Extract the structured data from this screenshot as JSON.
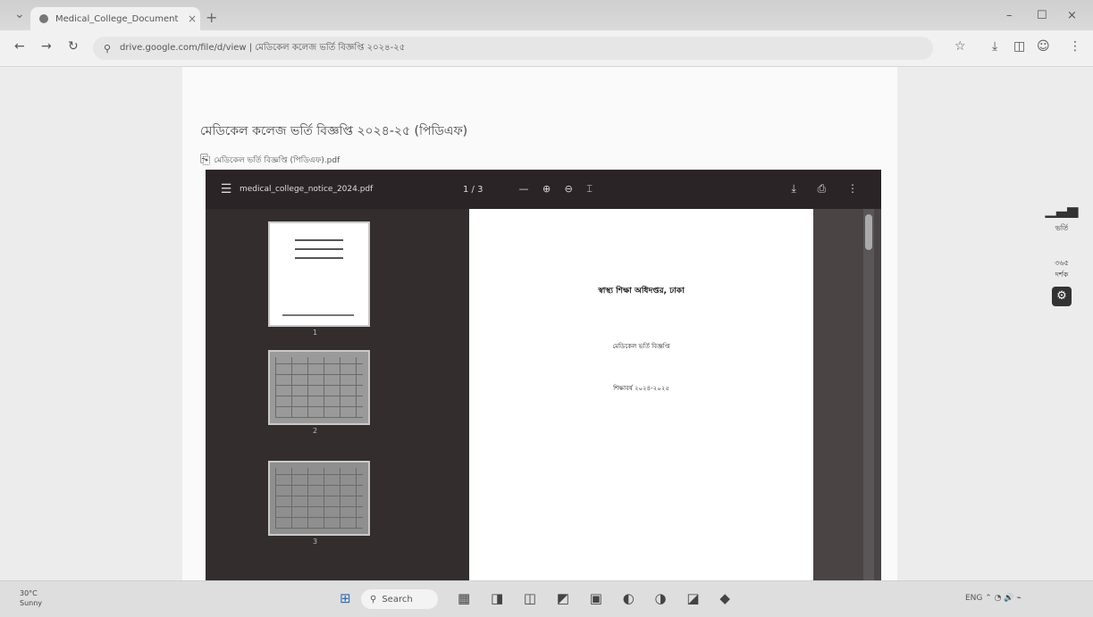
{
  "browser": {
    "tab_title": "Medical_College_Document",
    "tab_close": "×",
    "new_tab": "+",
    "url": "drive.google.com/file/d/view | মেডিকেল কলেজ ভর্তি বিজ্ঞপ্তি ২০২৪-২৫",
    "back": "←",
    "forward": "→",
    "reload": "↻",
    "minimize": "–",
    "maximize": "☐",
    "close": "×",
    "icons": [
      "star-icon",
      "download-icon",
      "extensions-icon",
      "profile-icon",
      "more-icon"
    ]
  },
  "page": {
    "heading": "মেডিকেল কলেজ ভর্তি বিজ্ঞপ্তি ২০২৪-২৫ (পিডিএফ)",
    "sublink": "মেডিকেল ভর্তি বিজ্ঞপ্তি (পিডিএফ).pdf"
  },
  "pdf_viewer": {
    "file_name": "medical_college_notice_2024.pdf",
    "page_indicator": "1 / 3",
    "zoom_controls": "— ⊕ ⊖ ⌶",
    "right_controls": "⤓ ⎙ ⋮",
    "thumb_page_numbers": [
      "1",
      "2",
      "3"
    ],
    "page": {
      "title": "স্বাস্থ্য শিক্ষা অধিদপ্তর, ঢাকা",
      "line2": "মেডিকেল ভর্তি বিজ্ঞপ্তি",
      "line3": "শিক্ষাবর্ষ ২০২৪-২০২৫"
    }
  },
  "side_widget": {
    "signal_label": "ভর্তি",
    "count_label": "৩৬৫",
    "count_sub": "দর্শক"
  },
  "taskbar": {
    "weather_temp": "30°C",
    "weather_desc": "Sunny",
    "search_placeholder": "Search",
    "apps": "▦ ◨ ◫ ◩ ▣ ◐ ◑ ◪ ◆",
    "tray": "ENG  ⌃  ◔  🔊  ⌁"
  }
}
